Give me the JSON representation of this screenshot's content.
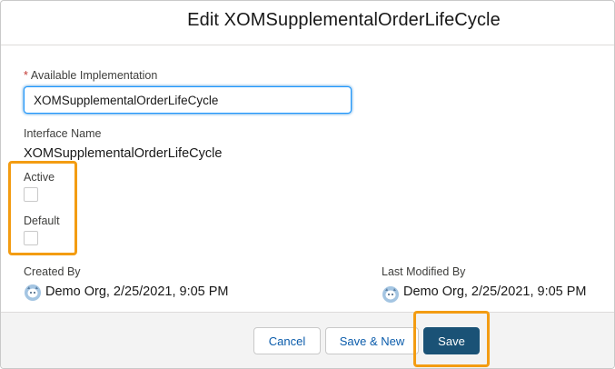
{
  "modal": {
    "title": "Edit XOMSupplementalOrderLifeCycle"
  },
  "form": {
    "available_implementation": {
      "required_marker": "*",
      "label": "Available Implementation",
      "value": "XOMSupplementalOrderLifeCycle"
    },
    "interface_name": {
      "label": "Interface Name",
      "value": "XOMSupplementalOrderLifeCycle"
    },
    "active": {
      "label": "Active",
      "checked": false
    },
    "default": {
      "label": "Default",
      "checked": false
    },
    "created_by": {
      "label": "Created By",
      "value": "Demo Org, 2/25/2021, 9:05 PM"
    },
    "last_modified_by": {
      "label": "Last Modified By",
      "value": "Demo Org, 2/25/2021, 9:05 PM"
    }
  },
  "footer": {
    "cancel_label": "Cancel",
    "save_new_label": "Save & New",
    "save_label": "Save"
  },
  "colors": {
    "highlight": "#f39c12",
    "brand_button": "#1a5276",
    "link_text": "#0b5cab",
    "focus_border": "#1b96ff"
  },
  "icons": {
    "avatar": "user-avatar-icon"
  }
}
